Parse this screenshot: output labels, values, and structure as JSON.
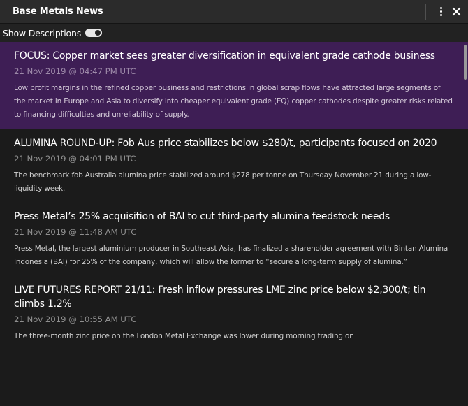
{
  "panel": {
    "title": "Base Metals News",
    "menu_icon": "vertical-ellipsis-icon",
    "close_icon": "close-icon"
  },
  "toolbar": {
    "show_descriptions_label": "Show Descriptions",
    "show_descriptions_on": true
  },
  "news": [
    {
      "title": "FOCUS: Copper market sees greater diversification in equivalent grade cathode business",
      "time": "21 Nov 2019 @ 04:47 PM UTC",
      "description": "Low profit margins in the refined copper business and restrictions in global scrap flows have attracted large segments of the market in Europe and Asia to diversify into cheaper equivalent grade (EQ) copper cathodes despite greater risks related to financing difficulties and unreliability of supply.",
      "selected": true
    },
    {
      "title": "ALUMINA ROUND-UP: Fob Aus price stabilizes below $280/t, participants focused on 2020",
      "time": "21 Nov 2019 @ 04:01 PM UTC",
      "description": "The benchmark fob Australia alumina price stabilized around $278 per tonne on Thursday November 21 during a low-liquidity week.",
      "selected": false
    },
    {
      "title": "Press Metal’s 25% acquisition of BAI to cut third-party alumina feedstock needs",
      "time": "21 Nov 2019 @ 11:48 AM UTC",
      "description": "Press Metal, the largest aluminium producer in Southeast Asia, has finalized a shareholder agreement with Bintan Alumina Indonesia (BAI) for 25% of the company, which will allow the former to “secure a long-term supply of alumina.”",
      "selected": false
    },
    {
      "title": "LIVE FUTURES REPORT 21/11: Fresh inflow pressures LME zinc price below $2,300/t; tin climbs 1.2%",
      "time": "21 Nov 2019 @ 10:55 AM UTC",
      "description": "The three-month zinc price on the London Metal Exchange was lower during morning trading on",
      "selected": false
    }
  ],
  "colors": {
    "selected_bg": "#3e1e55",
    "header_bg": "#2b2b2b",
    "panel_bg": "#1b1b1b"
  }
}
